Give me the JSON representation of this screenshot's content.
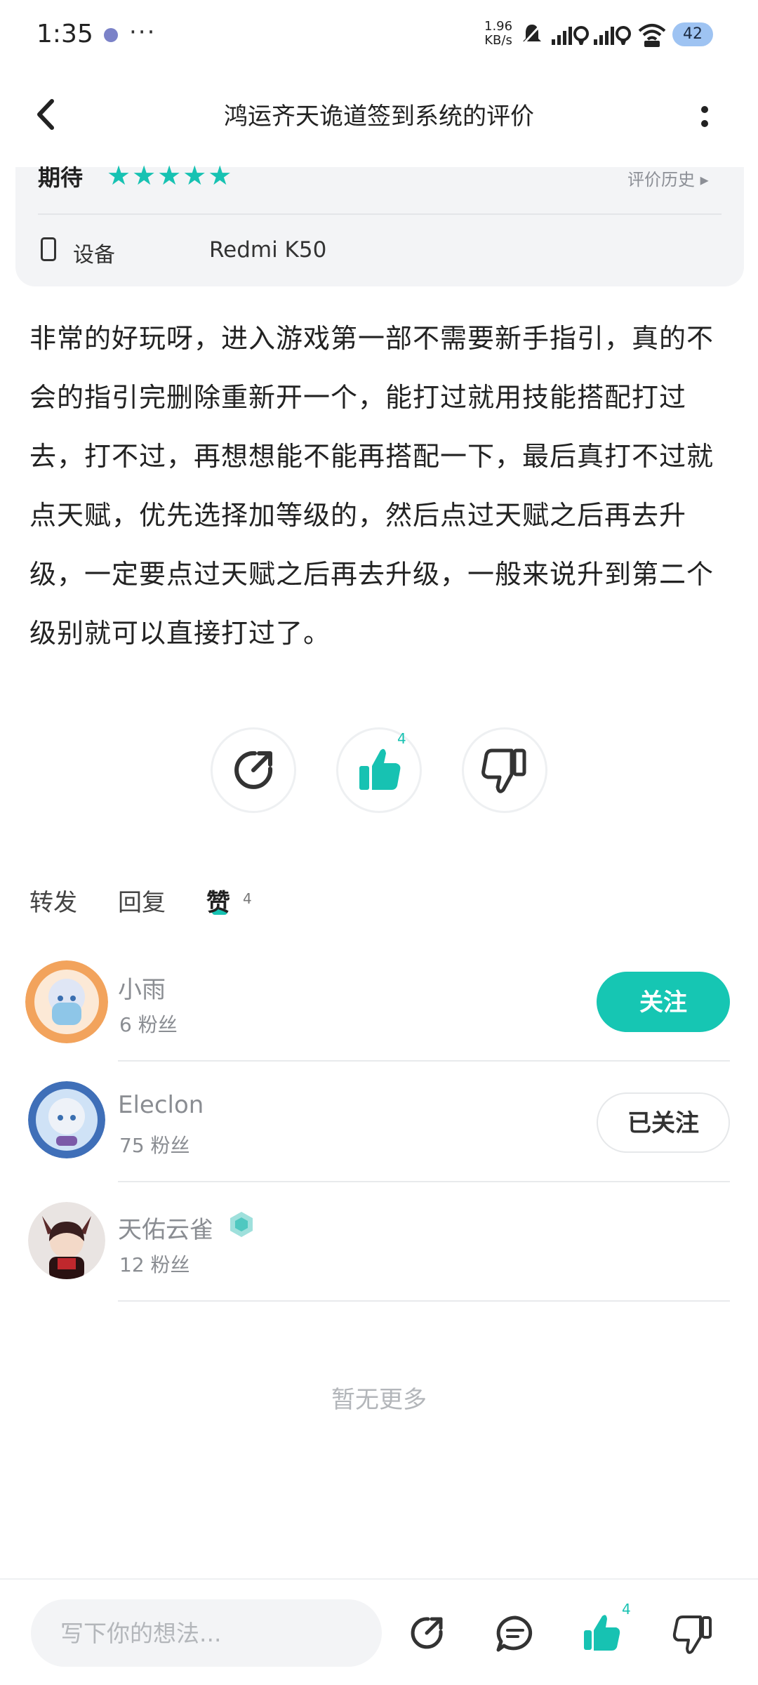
{
  "status_bar": {
    "time": "1:35",
    "more": "···",
    "net_speed_value": "1.96",
    "net_speed_unit": "KB/s",
    "battery": "42"
  },
  "header": {
    "title": "鸿运齐天诡道签到系统的评价"
  },
  "rating": {
    "label": "期待",
    "stars": "★★★★★",
    "star_count": 5,
    "history_link": "评价历史 ▸",
    "device_label": "设备",
    "device_value": "Redmi K50"
  },
  "review": {
    "text": "非常的好玩呀，进入游戏第一部不需要新手指引，真的不会的指引完删除重新开一个，能打过就用技能搭配打过去，打不过，再想想能不能再搭配一下，最后真打不过就点天赋，优先选择加等级的，然后点过天赋之后再去升级，一定要点过天赋之后再去升级，一般来说升到第二个级别就可以直接打过了。"
  },
  "actions": {
    "like_count": "4"
  },
  "tabs": [
    {
      "label": "转发"
    },
    {
      "label": "回复"
    },
    {
      "label": "赞",
      "count": "4"
    }
  ],
  "users": [
    {
      "name": "小雨",
      "fans": "6 粉丝",
      "button": "关注"
    },
    {
      "name": "Eleclon",
      "fans": "75 粉丝",
      "button": "已关注"
    },
    {
      "name": "天佑云雀",
      "fans": "12 粉丝"
    }
  ],
  "footer": {
    "no_more": "暂无更多",
    "input_placeholder": "写下你的想法...",
    "like_count": "4"
  },
  "colors": {
    "accent": "#16c6b3",
    "muted": "#8a8d92"
  }
}
